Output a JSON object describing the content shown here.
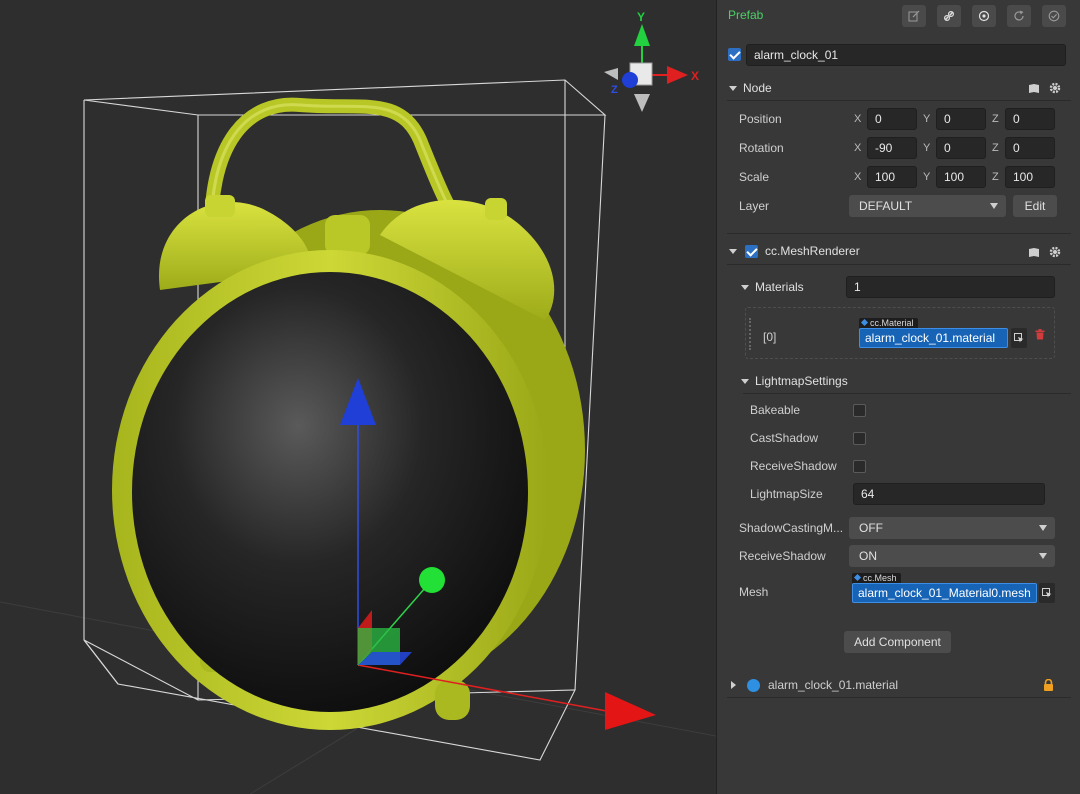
{
  "scene": {
    "gizmo": {
      "x_label": "X",
      "y_label": "Y",
      "z_label": "Z"
    }
  },
  "inspector": {
    "title": "Prefab",
    "node_name": "alarm_clock_01",
    "node": {
      "header": "Node",
      "position_label": "Position",
      "rotation_label": "Rotation",
      "scale_label": "Scale",
      "layer_label": "Layer",
      "axis_x": "X",
      "axis_y": "Y",
      "axis_z": "Z",
      "position": {
        "x": "0",
        "y": "0",
        "z": "0"
      },
      "rotation": {
        "x": "-90",
        "y": "0",
        "z": "0"
      },
      "scale": {
        "x": "100",
        "y": "100",
        "z": "100"
      },
      "layer_value": "DEFAULT",
      "edit_label": "Edit"
    },
    "mesh_renderer": {
      "header": "cc.MeshRenderer",
      "materials_label": "Materials",
      "materials_count": "1",
      "material_index": "[0]",
      "material_type": "cc.Material",
      "material_value": "alarm_clock_01.material",
      "lightmap_header": "LightmapSettings",
      "bakeable_label": "Bakeable",
      "castshadow_label": "CastShadow",
      "receiveshadow_label": "ReceiveShadow",
      "lightmapsize_label": "LightmapSize",
      "lightmapsize_value": "64",
      "shadowcasting_label": "ShadowCastingM...",
      "shadowcasting_value": "OFF",
      "receiveshadow2_label": "ReceiveShadow",
      "receiveshadow2_value": "ON",
      "mesh_label": "Mesh",
      "mesh_type": "cc.Mesh",
      "mesh_value": "alarm_clock_01_Material0.mesh"
    },
    "add_component_label": "Add Component",
    "material_asset": "alarm_clock_01.material"
  },
  "colors": {
    "prefab_green": "#4dd068",
    "selection_blue": "#1764b7",
    "clock_body": "#c4d22f"
  }
}
